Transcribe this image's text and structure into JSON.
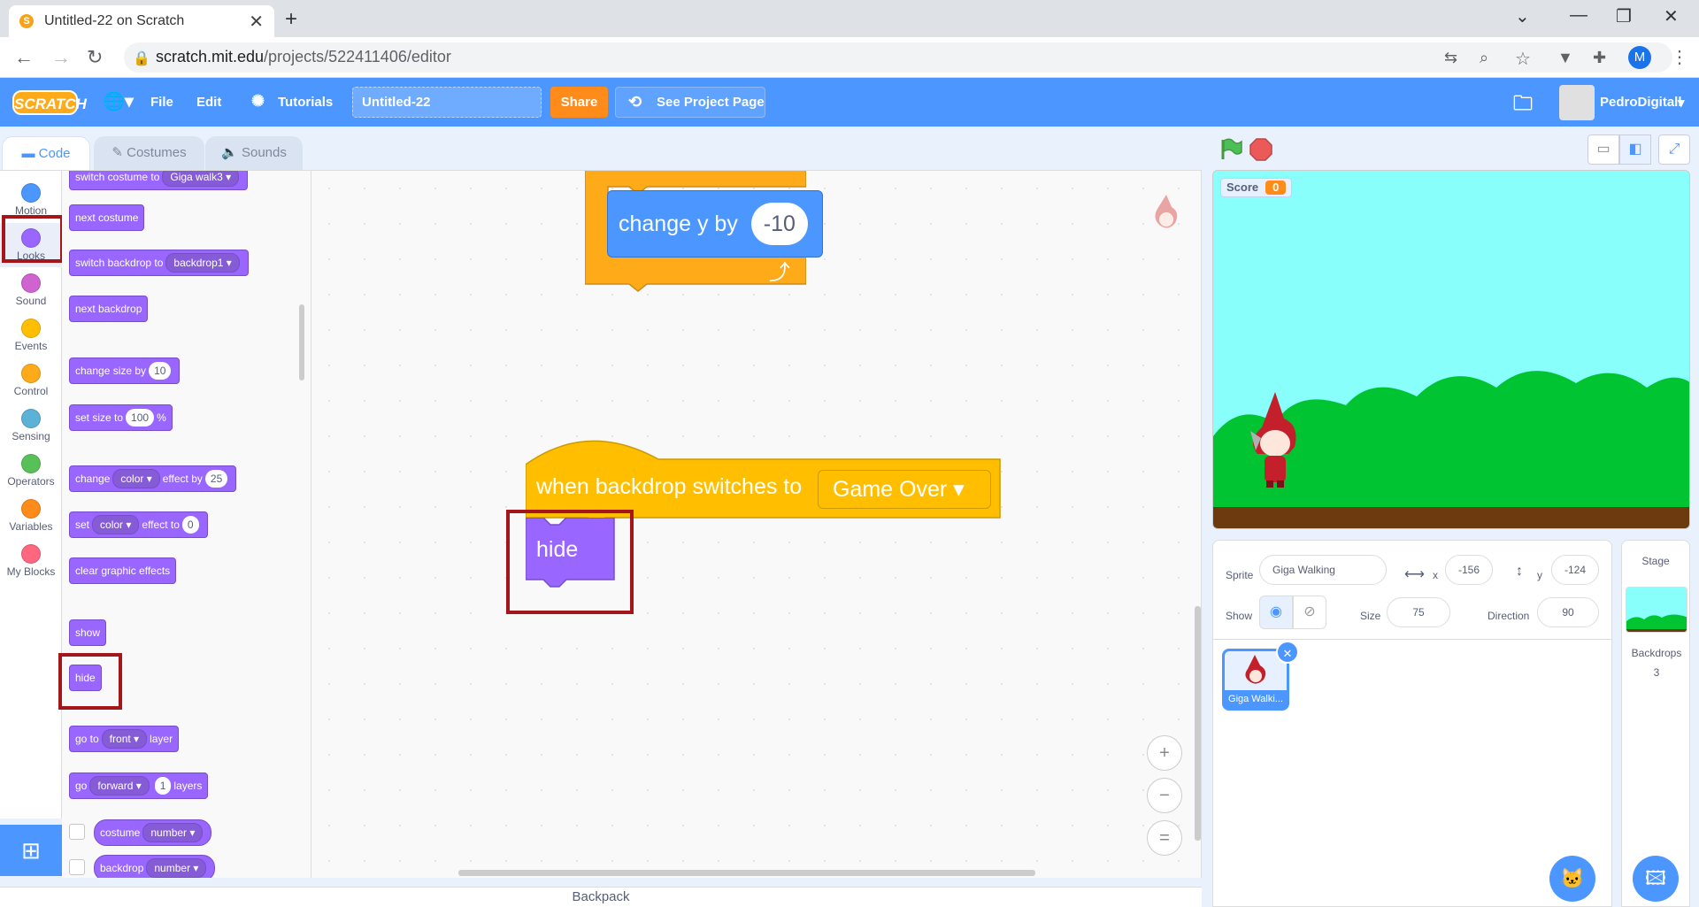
{
  "browser": {
    "tab_title": "Untitled-22 on Scratch",
    "url_host": "scratch.mit.edu",
    "url_path": "/projects/522411406/editor",
    "profile_initial": "M"
  },
  "menubar": {
    "logo": "SCRATCH",
    "file": "File",
    "edit": "Edit",
    "tutorials": "Tutorials",
    "project_title": "Untitled-22",
    "share": "Share",
    "see_project_page": "See Project Page",
    "username": "PedroDigitall"
  },
  "tabs": {
    "code": "Code",
    "costumes": "Costumes",
    "sounds": "Sounds"
  },
  "categories": [
    {
      "label": "Motion",
      "color": "#4c97ff"
    },
    {
      "label": "Looks",
      "color": "#9966ff"
    },
    {
      "label": "Sound",
      "color": "#cf63cf"
    },
    {
      "label": "Events",
      "color": "#ffbf00"
    },
    {
      "label": "Control",
      "color": "#ffab19"
    },
    {
      "label": "Sensing",
      "color": "#5cb1d6"
    },
    {
      "label": "Operators",
      "color": "#59c059"
    },
    {
      "label": "Variables",
      "color": "#ff8c1a"
    },
    {
      "label": "My Blocks",
      "color": "#ff6680"
    }
  ],
  "palette": {
    "switch_costume": {
      "text": "switch costume to",
      "value": "Giga walk3"
    },
    "next_costume": "next costume",
    "switch_backdrop": {
      "text": "switch backdrop to",
      "value": "backdrop1"
    },
    "next_backdrop": "next backdrop",
    "change_size": {
      "text": "change size by",
      "value": "10"
    },
    "set_size": {
      "text": "set size to",
      "value": "100",
      "suffix": "%"
    },
    "change_effect": {
      "text1": "change",
      "effect": "color",
      "text2": "effect by",
      "value": "25"
    },
    "set_effect": {
      "text1": "set",
      "effect": "color",
      "text2": "effect to",
      "value": "0"
    },
    "clear_effects": "clear graphic effects",
    "show": "show",
    "hide": "hide",
    "go_to_layer": {
      "text1": "go to",
      "value": "front",
      "text2": "layer"
    },
    "go_layers": {
      "text1": "go",
      "dir": "forward",
      "value": "1",
      "text2": "layers"
    },
    "costume_reporter": {
      "text": "costume",
      "value": "number"
    },
    "backdrop_reporter": {
      "text": "backdrop",
      "value": "number"
    }
  },
  "code": {
    "change_y": {
      "text": "change y by",
      "value": "-10"
    },
    "hat": {
      "text": "when backdrop switches to",
      "value": "Game Over"
    },
    "hide": "hide"
  },
  "zoom": {
    "in": "+",
    "out": "−",
    "reset": "="
  },
  "backpack": "Backpack",
  "stage": {
    "score_label": "Score",
    "score_value": "0"
  },
  "sprite_info": {
    "sprite_label": "Sprite",
    "sprite_name": "Giga Walking",
    "x_label": "x",
    "x_value": "-156",
    "y_label": "y",
    "y_value": "-124",
    "show_label": "Show",
    "size_label": "Size",
    "size_value": "75",
    "direction_label": "Direction",
    "direction_value": "90"
  },
  "sprite_list": [
    {
      "name": "Giga Walki..."
    }
  ],
  "stage_pane": {
    "title": "Stage",
    "backdrops_label": "Backdrops",
    "backdrops_count": "3"
  }
}
